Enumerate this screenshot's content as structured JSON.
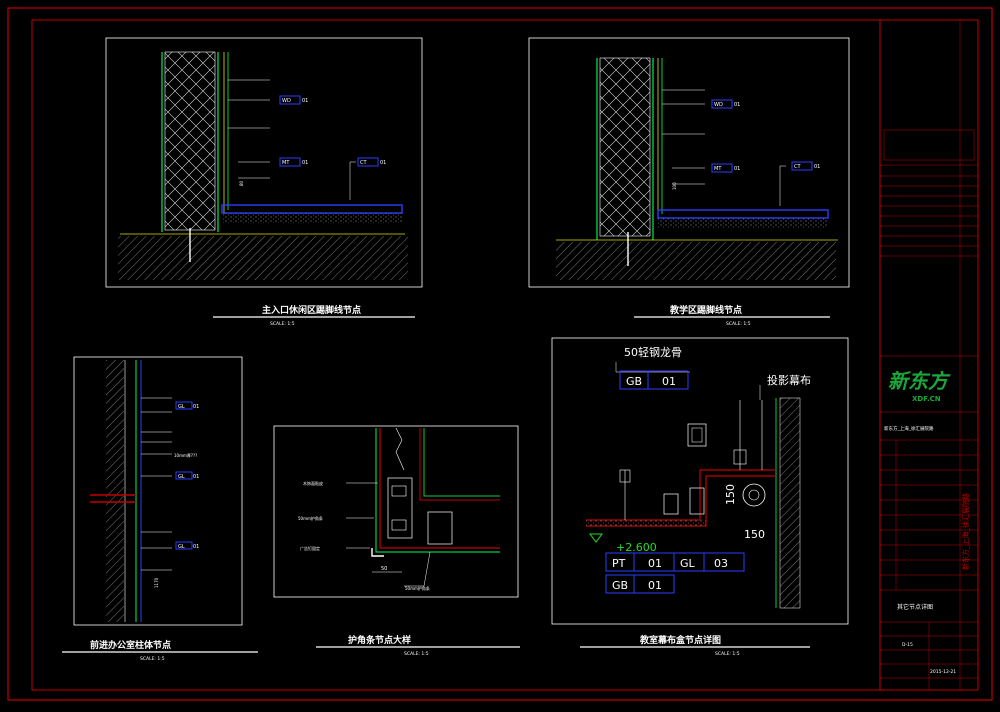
{
  "colors": {
    "background": "#000000",
    "border": "#c00000",
    "wall": "#00cc44",
    "floor_tile": "#2b3cff",
    "accent": "#e0e000",
    "logo": "#1aa83a"
  },
  "details": {
    "d1": {
      "title": "主入口休闲区踢脚线节点",
      "scale": "SCALE: 1:5",
      "tags": [
        {
          "code": "WD",
          "num": "01"
        },
        {
          "code": "MT",
          "num": "01"
        },
        {
          "code": "CT",
          "num": "01"
        }
      ],
      "dim": "80"
    },
    "d2": {
      "title": "教学区踢脚线节点",
      "scale": "SCALE: 1:5",
      "tags": [
        {
          "code": "WD",
          "num": "01"
        },
        {
          "code": "MT",
          "num": "01"
        },
        {
          "code": "CT",
          "num": "01"
        }
      ],
      "dim": "100"
    },
    "d3": {
      "title": "前进办公室柱体节点",
      "scale": "SCALE: 1:5",
      "tags": [
        {
          "code": "GL",
          "num": "01"
        },
        {
          "code": "GL",
          "num": "01"
        },
        {
          "code": "GL",
          "num": "01"
        }
      ],
      "note": "10mm厚???",
      "dim": "1170"
    },
    "d4": {
      "title": "护角条节点大样",
      "scale": "SCALE: 1:5",
      "labels": [
        "木饰面贴皮",
        "50mm护角条",
        "广告钉固定",
        "50mm护角条"
      ],
      "dim": "50"
    },
    "d5": {
      "title": "教室幕布盒节点详图",
      "scale": "SCALE: 1:5",
      "top_label": "50轻钢龙骨",
      "right_label": "投影幕布",
      "level": "+2.600",
      "dim1": "150",
      "dim2": "150",
      "tags": [
        {
          "code": "GB",
          "num": "01"
        },
        {
          "code": "PT",
          "num": "01"
        },
        {
          "code": "GL",
          "num": "03"
        },
        {
          "code": "GB",
          "num": "01"
        }
      ]
    }
  },
  "title_block": {
    "logo_cn": "新东方",
    "logo_en": "XDF.CN",
    "project": "新东方_上海_徐汇展院路",
    "drawing_name": "其它节点详图",
    "drawing_no": "D-15",
    "date": "2015-12-21",
    "side_text": "新东方_上海_徐汇展院路"
  }
}
